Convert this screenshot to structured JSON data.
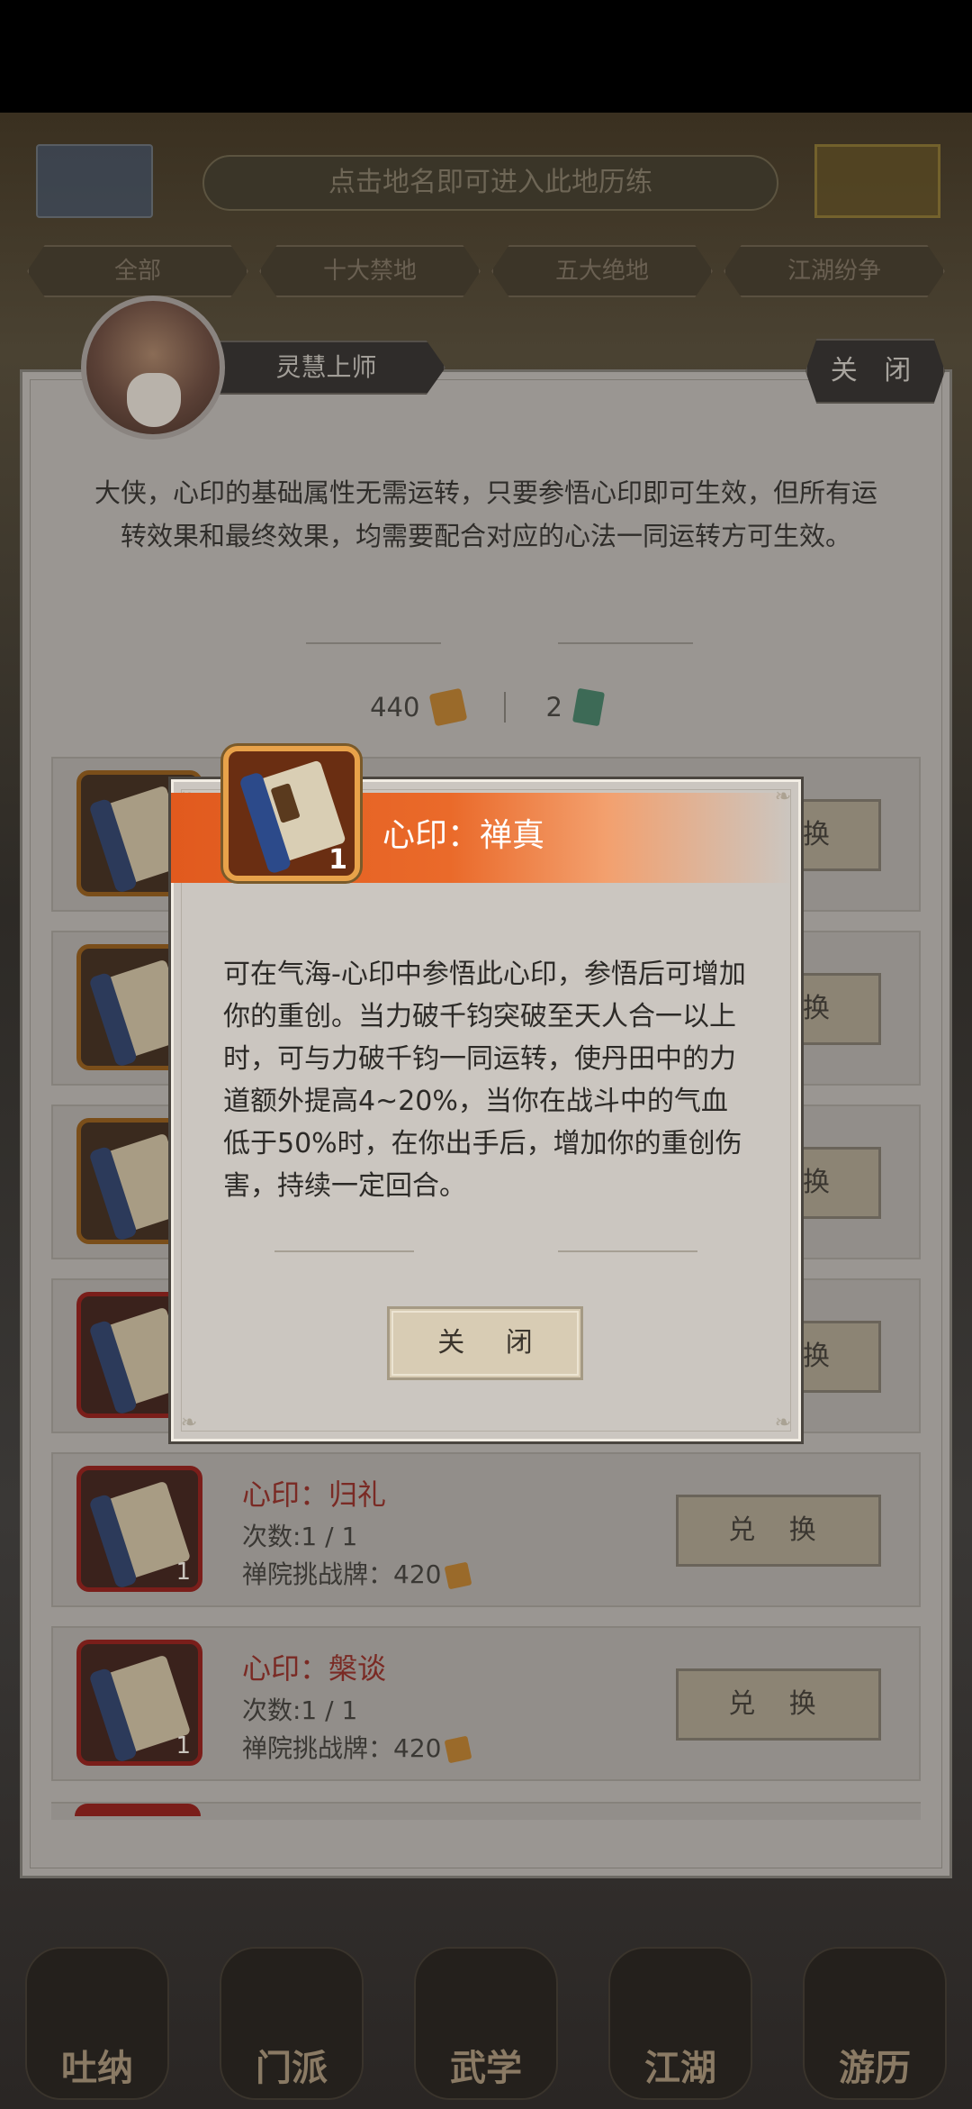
{
  "background": {
    "hint_text": "点击地名即可进入此地历练",
    "filter_tabs": [
      "全部",
      "十大禁地",
      "五大绝地",
      "江湖纷争"
    ],
    "bottom_nav": [
      "吐纳",
      "门派",
      "武学",
      "江湖",
      "游历"
    ]
  },
  "panel": {
    "npc_name": "灵慧上师",
    "close_label": "关 闭",
    "intro_text": "大侠，心印的基础属性无需运转，只要参悟心印即可生效，但所有运转效果和最终效果，均需要配合对应的心法一同运转方可生效。",
    "currency": {
      "coins": "440",
      "jade": "2"
    },
    "items": [
      {
        "title": "心印：归礼",
        "count_line": "次数:1 / 1",
        "cost_line": "禅院挑战牌：420",
        "icon_badge": "1",
        "button": "兑 换"
      },
      {
        "title": "心印：槃谈",
        "count_line": "次数:1 / 1",
        "cost_line": "禅院挑战牌：420",
        "icon_badge": "1",
        "button": "兑 换"
      }
    ],
    "hidden_buttons": [
      "换",
      "换",
      "换",
      "换"
    ]
  },
  "modal": {
    "title": "心印：禅真",
    "icon_count": "1",
    "description": "可在气海-心印中参悟此心印，参悟后可增加你的重创。当力破千钧突破至天人合一以上时，可与力破千钧一同运转，使丹田中的力道额外提高4~20%，当你在战斗中的气血低于50%时，在你出手后，增加你的重创伤害，持续一定回合。",
    "close_label": "关 闭"
  },
  "colors": {
    "banner_orange": "#e15a1e",
    "item_title_red": "#7a2a24",
    "icon_frame_gold": "#e8a24a"
  }
}
